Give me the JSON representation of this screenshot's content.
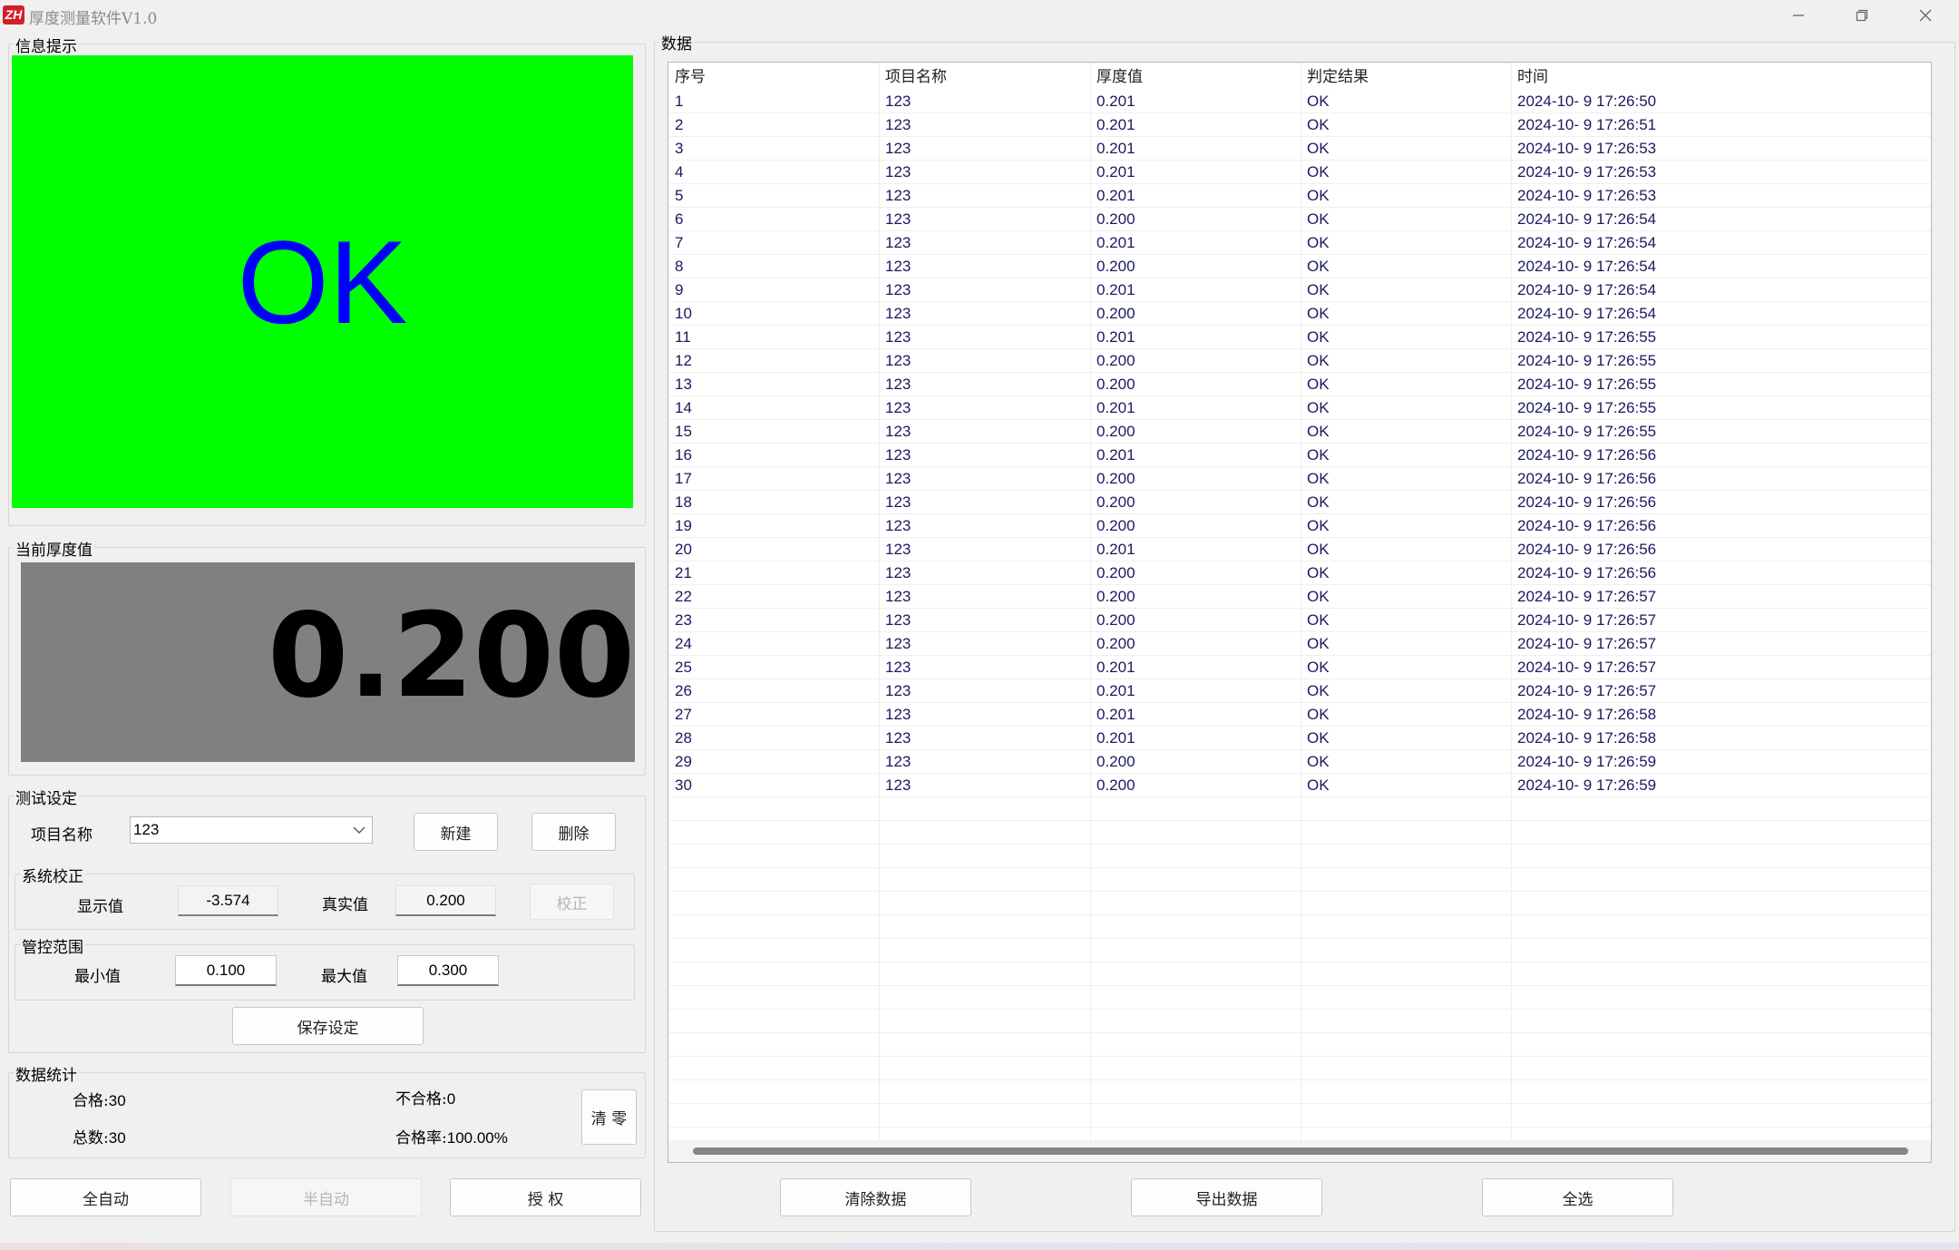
{
  "window": {
    "title": "厚度测量软件V1.0",
    "logo_text": "ZH"
  },
  "info_panel": {
    "label": "信息提示",
    "status_text": "OK",
    "bg_color": "#00ff00",
    "text_color": "#0000ff"
  },
  "thickness_panel": {
    "label": "当前厚度值",
    "value": "0.200"
  },
  "settings": {
    "label": "测试设定",
    "project_label": "项目名称",
    "project_value": "123",
    "new_button": "新建",
    "delete_button": "删除",
    "calibration": {
      "label": "系统校正",
      "display_label": "显示值",
      "display_value": "-3.574",
      "real_label": "真实值",
      "real_value": "0.200",
      "calibrate_button": "校正"
    },
    "range": {
      "label": "管控范围",
      "min_label": "最小值",
      "min_value": "0.100",
      "max_label": "最大值",
      "max_value": "0.300"
    },
    "save_button": "保存设定"
  },
  "stats": {
    "label": "数据统计",
    "pass_label": "合格:",
    "pass_value": "30",
    "fail_label": "不合格:",
    "fail_value": "0",
    "total_label": "总数:",
    "total_value": "30",
    "rate_label": "合格率:",
    "rate_value": "100.00%",
    "clear_button": "清 零"
  },
  "bottom_left_buttons": {
    "full_auto": "全自动",
    "semi_auto": "半自动",
    "authorize": "授 权"
  },
  "data_panel": {
    "label": "数据",
    "headers": [
      "序号",
      "项目名称",
      "厚度值",
      "判定结果",
      "时间"
    ],
    "rows": [
      [
        "1",
        "123",
        "0.201",
        "OK",
        "2024-10- 9 17:26:50"
      ],
      [
        "2",
        "123",
        "0.201",
        "OK",
        "2024-10- 9 17:26:51"
      ],
      [
        "3",
        "123",
        "0.201",
        "OK",
        "2024-10- 9 17:26:53"
      ],
      [
        "4",
        "123",
        "0.201",
        "OK",
        "2024-10- 9 17:26:53"
      ],
      [
        "5",
        "123",
        "0.201",
        "OK",
        "2024-10- 9 17:26:53"
      ],
      [
        "6",
        "123",
        "0.200",
        "OK",
        "2024-10- 9 17:26:54"
      ],
      [
        "7",
        "123",
        "0.201",
        "OK",
        "2024-10- 9 17:26:54"
      ],
      [
        "8",
        "123",
        "0.200",
        "OK",
        "2024-10- 9 17:26:54"
      ],
      [
        "9",
        "123",
        "0.201",
        "OK",
        "2024-10- 9 17:26:54"
      ],
      [
        "10",
        "123",
        "0.200",
        "OK",
        "2024-10- 9 17:26:54"
      ],
      [
        "11",
        "123",
        "0.201",
        "OK",
        "2024-10- 9 17:26:55"
      ],
      [
        "12",
        "123",
        "0.200",
        "OK",
        "2024-10- 9 17:26:55"
      ],
      [
        "13",
        "123",
        "0.200",
        "OK",
        "2024-10- 9 17:26:55"
      ],
      [
        "14",
        "123",
        "0.201",
        "OK",
        "2024-10- 9 17:26:55"
      ],
      [
        "15",
        "123",
        "0.200",
        "OK",
        "2024-10- 9 17:26:55"
      ],
      [
        "16",
        "123",
        "0.201",
        "OK",
        "2024-10- 9 17:26:56"
      ],
      [
        "17",
        "123",
        "0.200",
        "OK",
        "2024-10- 9 17:26:56"
      ],
      [
        "18",
        "123",
        "0.200",
        "OK",
        "2024-10- 9 17:26:56"
      ],
      [
        "19",
        "123",
        "0.200",
        "OK",
        "2024-10- 9 17:26:56"
      ],
      [
        "20",
        "123",
        "0.201",
        "OK",
        "2024-10- 9 17:26:56"
      ],
      [
        "21",
        "123",
        "0.200",
        "OK",
        "2024-10- 9 17:26:56"
      ],
      [
        "22",
        "123",
        "0.200",
        "OK",
        "2024-10- 9 17:26:57"
      ],
      [
        "23",
        "123",
        "0.200",
        "OK",
        "2024-10- 9 17:26:57"
      ],
      [
        "24",
        "123",
        "0.200",
        "OK",
        "2024-10- 9 17:26:57"
      ],
      [
        "25",
        "123",
        "0.201",
        "OK",
        "2024-10- 9 17:26:57"
      ],
      [
        "26",
        "123",
        "0.201",
        "OK",
        "2024-10- 9 17:26:57"
      ],
      [
        "27",
        "123",
        "0.201",
        "OK",
        "2024-10- 9 17:26:58"
      ],
      [
        "28",
        "123",
        "0.201",
        "OK",
        "2024-10- 9 17:26:58"
      ],
      [
        "29",
        "123",
        "0.200",
        "OK",
        "2024-10- 9 17:26:59"
      ],
      [
        "30",
        "123",
        "0.200",
        "OK",
        "2024-10- 9 17:26:59"
      ]
    ],
    "buttons": {
      "clear_data": "清除数据",
      "export_data": "导出数据",
      "select_all": "全选"
    }
  }
}
